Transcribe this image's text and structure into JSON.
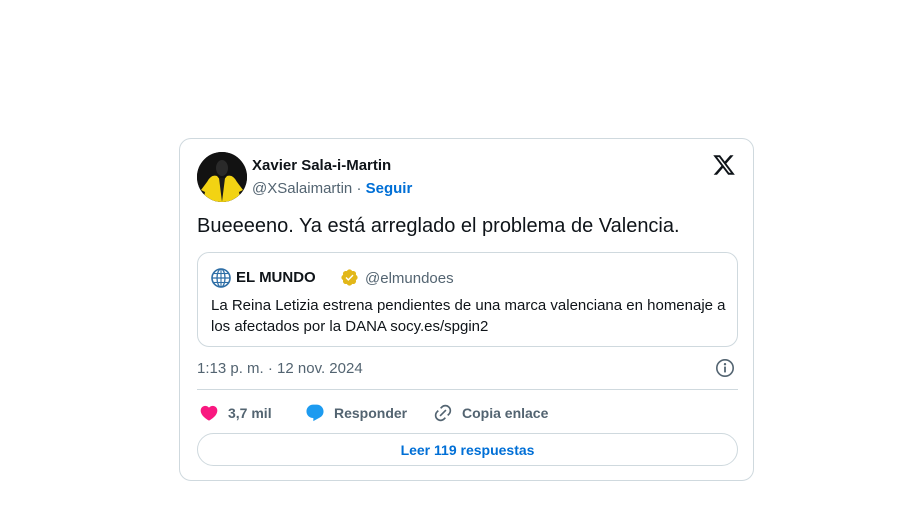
{
  "author": {
    "name": "Xavier Sala-i-Martin",
    "handle": "@XSalaimartin",
    "separator": "·",
    "follow_label": "Seguir"
  },
  "tweet": {
    "text": "Bueeeeno. Ya está arreglado el problema de Valencia.",
    "timestamp": "1:13 p. m. · 12 nov. 2024"
  },
  "quoted": {
    "name": "EL MUNDO",
    "handle": "@elmundoes",
    "text": "La Reina Letizia estrena pendientes de una marca valenciana en homenaje a los afectados por la DANA socy.es/spgin2"
  },
  "actions": {
    "likes": "3,7 mil",
    "reply_label": "Responder",
    "copy_label": "Copia enlace",
    "read_replies_label": "Leer 119 respuestas"
  },
  "icons": {
    "logo": "x-logo-icon",
    "like": "heart-icon",
    "reply": "speech-bubble-icon",
    "copy": "link-icon",
    "info": "info-icon",
    "verified": "verified-badge-icon",
    "quoted_avatar": "globe-icon"
  },
  "colors": {
    "accent": "#006fd6",
    "like": "#f91880",
    "reply": "#1d9bf0",
    "verified": "#e2b719",
    "muted": "#536471",
    "border": "#cfd9de"
  }
}
